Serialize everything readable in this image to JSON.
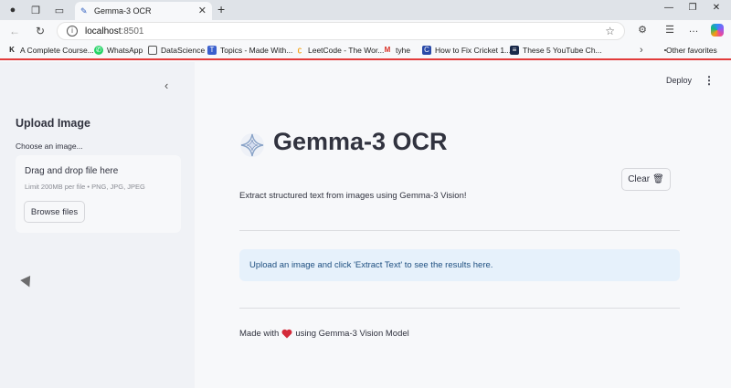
{
  "browser": {
    "tab_title": "Gemma-3 OCR",
    "tab_close_glyph": "✕",
    "new_tab_glyph": "+",
    "url_host": "localhost",
    "url_port": ":8501",
    "bookmarks": [
      {
        "label": "A Complete Course...",
        "icon": "k-logo-icon"
      },
      {
        "label": "WhatsApp",
        "icon": "whatsapp-icon"
      },
      {
        "label": "DataScience",
        "icon": "folder-icon"
      },
      {
        "label": "Topics - Made With...",
        "icon": "site-icon"
      },
      {
        "label": "LeetCode - The Wor...",
        "icon": "leetcode-icon"
      },
      {
        "label": "tyhe",
        "icon": "gmail-icon"
      },
      {
        "label": "How to Fix Cricket 1...",
        "icon": "site-icon"
      },
      {
        "label": "These 5 YouTube Ch...",
        "icon": "site-icon"
      }
    ],
    "other_favorites": "Other favorites"
  },
  "sidebar": {
    "title": "Upload Image",
    "file_label": "Choose an image...",
    "dropzone_title": "Drag and drop file here",
    "dropzone_limit": "Limit 200MB per file • PNG, JPG, JPEG",
    "browse_label": "Browse files"
  },
  "header": {
    "deploy_label": "Deploy",
    "menu_glyph": "⋮"
  },
  "main": {
    "title": "Gemma-3 OCR",
    "clear_label": "Clear",
    "clear_icon": "🗑",
    "subtitle": "Extract structured text from images using Gemma-3 Vision!",
    "info_message": "Upload an image and click 'Extract Text' to see the results here.",
    "footer_before": "Made with",
    "footer_after": "using Gemma-3 Vision Model"
  },
  "colors": {
    "accent_red": "#e23b3b",
    "info_bg": "#e6f1fb",
    "info_text": "#1e4f80",
    "sidebar_bg": "#f0f2f6"
  }
}
